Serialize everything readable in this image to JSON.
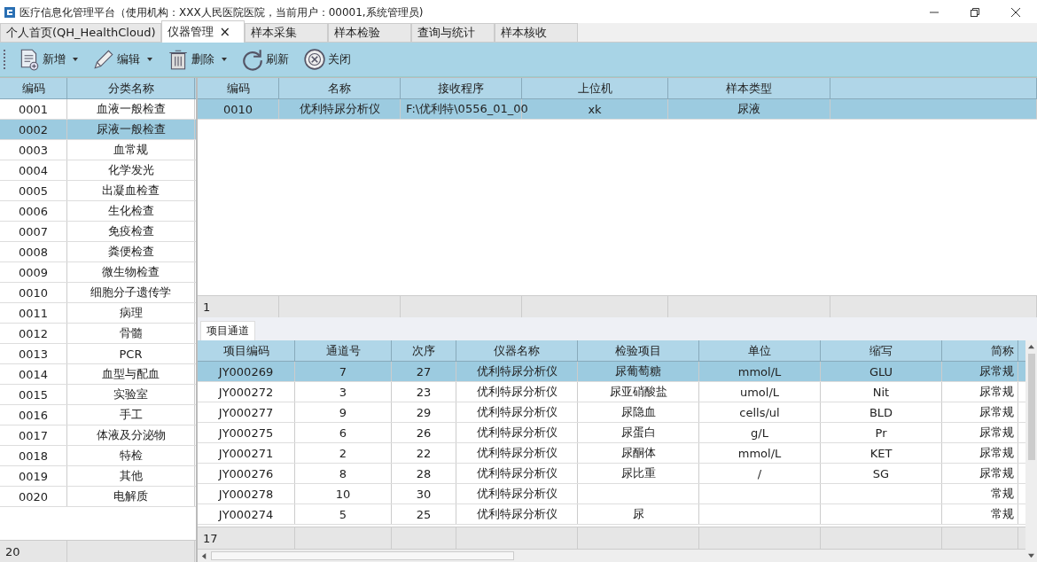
{
  "window": {
    "title": "医疗信息化管理平台（使用机构：XXX人民医院医院，当前用户：00001,系统管理员)"
  },
  "tabs": [
    {
      "label": "个人首页(QH_HealthCloud)",
      "selected": false
    },
    {
      "label": "仪器管理",
      "selected": true,
      "close": "×"
    },
    {
      "label": "样本采集",
      "selected": false
    },
    {
      "label": "样本检验",
      "selected": false
    },
    {
      "label": "查询与统计",
      "selected": false
    },
    {
      "label": "样本核收",
      "selected": false
    }
  ],
  "toolbar": [
    {
      "label": "新增",
      "kind": "add",
      "dropdown": true
    },
    {
      "label": "编辑",
      "kind": "edit",
      "dropdown": true
    },
    {
      "label": "删除",
      "kind": "delete",
      "dropdown": true
    },
    {
      "label": "刷新",
      "kind": "refresh",
      "dropdown": false
    },
    {
      "label": "关闭",
      "kind": "close",
      "dropdown": false
    }
  ],
  "categories": {
    "columns": [
      "编码",
      "分类名称"
    ],
    "rows": [
      {
        "code": "0001",
        "name": "血液一般检查",
        "selected": false
      },
      {
        "code": "0002",
        "name": "尿液一般检查",
        "selected": true
      },
      {
        "code": "0003",
        "name": "血常规",
        "selected": false
      },
      {
        "code": "0004",
        "name": "化学发光",
        "selected": false
      },
      {
        "code": "0005",
        "name": "出凝血检查",
        "selected": false
      },
      {
        "code": "0006",
        "name": "生化检查",
        "selected": false
      },
      {
        "code": "0007",
        "name": "免疫检查",
        "selected": false
      },
      {
        "code": "0008",
        "name": "粪便检查",
        "selected": false
      },
      {
        "code": "0009",
        "name": "微生物检查",
        "selected": false
      },
      {
        "code": "0010",
        "name": "细胞分子遗传学",
        "selected": false
      },
      {
        "code": "0011",
        "name": "病理",
        "selected": false
      },
      {
        "code": "0012",
        "name": "骨髓",
        "selected": false
      },
      {
        "code": "0013",
        "name": "PCR",
        "selected": false
      },
      {
        "code": "0014",
        "name": "血型与配血",
        "selected": false
      },
      {
        "code": "0015",
        "name": "实验室",
        "selected": false
      },
      {
        "code": "0016",
        "name": "手工",
        "selected": false
      },
      {
        "code": "0017",
        "name": "体液及分泌物",
        "selected": false
      },
      {
        "code": "0018",
        "name": "特检",
        "selected": false
      },
      {
        "code": "0019",
        "name": "其他",
        "selected": false
      },
      {
        "code": "0020",
        "name": "电解质",
        "selected": false
      }
    ],
    "count": "20"
  },
  "instruments": {
    "columns": [
      "编码",
      "名称",
      "接收程序",
      "上位机",
      "样本类型"
    ],
    "rows": [
      {
        "cells": [
          "0010",
          "优利特尿分析仪",
          "F:\\优利特\\0556_01_00",
          "xk",
          "尿液"
        ],
        "selected": true
      }
    ],
    "count": "1"
  },
  "channels": {
    "title": "项目通道",
    "columns": [
      "项目编码",
      "通道号",
      "次序",
      "仪器名称",
      "检验项目",
      "单位",
      "缩写",
      "简称"
    ],
    "rows": [
      {
        "cells": [
          "JY000269",
          "7",
          "27",
          "优利特尿分析仪",
          "尿葡萄糖",
          "mmol/L",
          "GLU",
          "尿常规"
        ],
        "selected": true
      },
      {
        "cells": [
          "JY000272",
          "3",
          "23",
          "优利特尿分析仪",
          "尿亚硝酸盐",
          "umol/L",
          "Nit",
          "尿常规"
        ],
        "selected": false
      },
      {
        "cells": [
          "JY000277",
          "9",
          "29",
          "优利特尿分析仪",
          "尿隐血",
          "cells/ul",
          "BLD",
          "尿常规"
        ],
        "selected": false
      },
      {
        "cells": [
          "JY000275",
          "6",
          "26",
          "优利特尿分析仪",
          "尿蛋白",
          "g/L",
          "Pr",
          "尿常规"
        ],
        "selected": false
      },
      {
        "cells": [
          "JY000271",
          "2",
          "22",
          "优利特尿分析仪",
          "尿酮体",
          "mmol/L",
          "KET",
          "尿常规"
        ],
        "selected": false
      },
      {
        "cells": [
          "JY000276",
          "8",
          "28",
          "优利特尿分析仪",
          "尿比重",
          "/",
          "SG",
          "尿常规"
        ],
        "selected": false
      },
      {
        "cells": [
          "JY000278",
          "10",
          "30",
          "优利特尿分析仪",
          null,
          null,
          null,
          "常规"
        ],
        "selected": false
      },
      {
        "cells": [
          "JY000274",
          "5",
          "25",
          "优利特尿分析仪",
          "尿",
          null,
          null,
          "常规"
        ],
        "selected": false
      }
    ],
    "count": "17"
  }
}
